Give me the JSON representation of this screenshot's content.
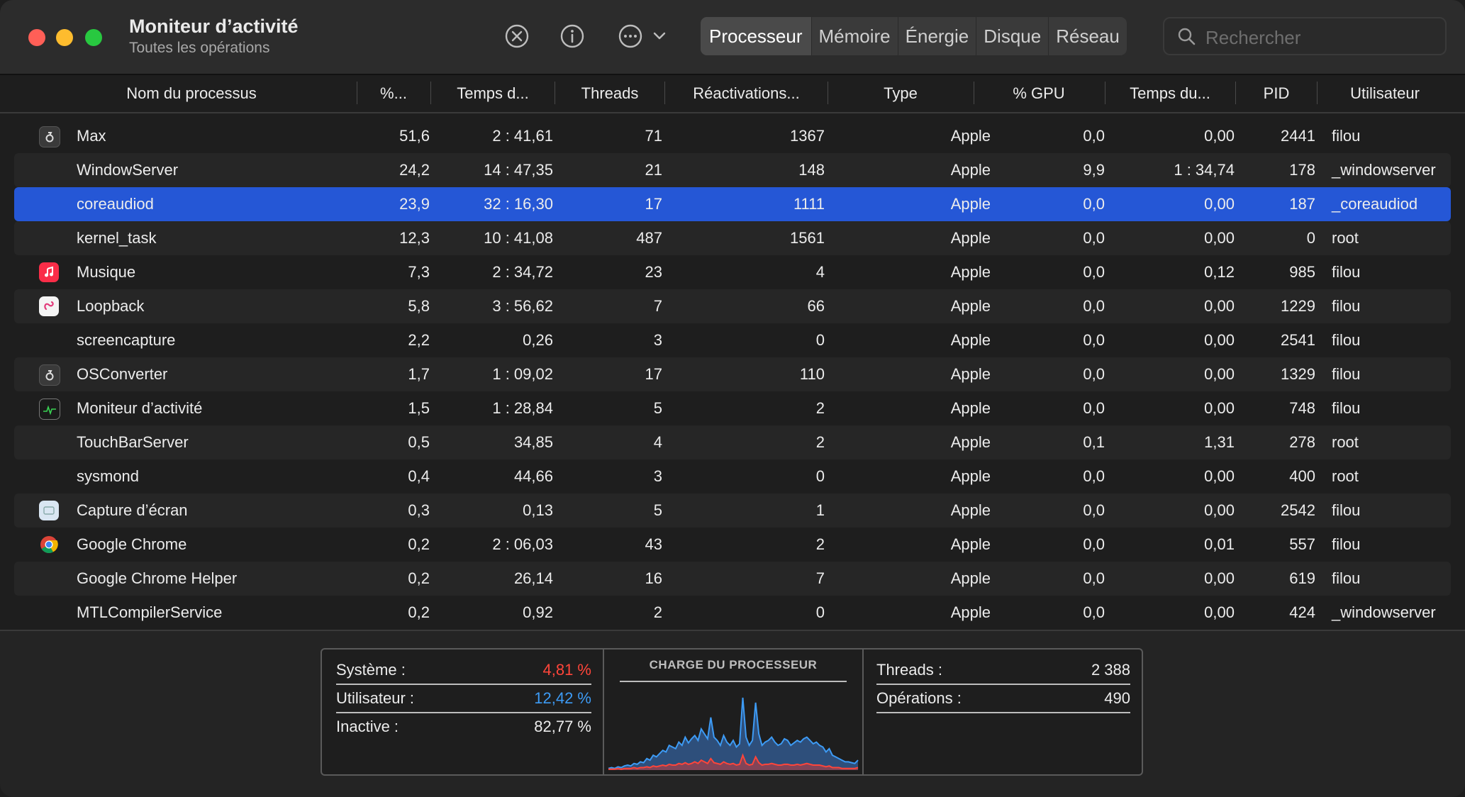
{
  "window": {
    "title": "Moniteur d’activité",
    "subtitle": "Toutes les opérations"
  },
  "toolbar": {
    "icons": [
      "stop-process-icon",
      "info-icon",
      "more-actions-icon",
      "chevron-down-icon"
    ],
    "tabs": [
      {
        "label": "Processeur",
        "active": true
      },
      {
        "label": "Mémoire",
        "active": false
      },
      {
        "label": "Énergie",
        "active": false
      },
      {
        "label": "Disque",
        "active": false
      },
      {
        "label": "Réseau",
        "active": false
      }
    ],
    "search_placeholder": "Rechercher"
  },
  "table": {
    "columns": [
      "Nom du processus",
      "%...",
      "Temps d...",
      "Threads",
      "Réactivations...",
      "Type",
      "% GPU",
      "Temps du...",
      "PID",
      "Utilisateur"
    ],
    "rows": [
      {
        "icon": "max-app-icon",
        "name": "Max",
        "cpu": "51,6",
        "time": "2 : 41,61",
        "threads": "71",
        "wakeups": "1367",
        "type": "Apple",
        "gpu": "0,0",
        "gputime": "0,00",
        "pid": "2441",
        "user": "filou"
      },
      {
        "icon": "",
        "name": "WindowServer",
        "cpu": "24,2",
        "time": "14 : 47,35",
        "threads": "21",
        "wakeups": "148",
        "type": "Apple",
        "gpu": "9,9",
        "gputime": "1 : 34,74",
        "pid": "178",
        "user": "_windowserver"
      },
      {
        "icon": "",
        "name": "coreaudiod",
        "cpu": "23,9",
        "time": "32 : 16,30",
        "threads": "17",
        "wakeups": "1111",
        "type": "Apple",
        "gpu": "0,0",
        "gputime": "0,00",
        "pid": "187",
        "user": "_coreaudiod",
        "selected": true
      },
      {
        "icon": "",
        "name": "kernel_task",
        "cpu": "12,3",
        "time": "10 : 41,08",
        "threads": "487",
        "wakeups": "1561",
        "type": "Apple",
        "gpu": "0,0",
        "gputime": "0,00",
        "pid": "0",
        "user": "root"
      },
      {
        "icon": "music-app-icon",
        "name": "Musique",
        "cpu": "7,3",
        "time": "2 : 34,72",
        "threads": "23",
        "wakeups": "4",
        "type": "Apple",
        "gpu": "0,0",
        "gputime": "0,12",
        "pid": "985",
        "user": "filou"
      },
      {
        "icon": "loopback-app-icon",
        "name": "Loopback",
        "cpu": "5,8",
        "time": "3 : 56,62",
        "threads": "7",
        "wakeups": "66",
        "type": "Apple",
        "gpu": "0,0",
        "gputime": "0,00",
        "pid": "1229",
        "user": "filou"
      },
      {
        "icon": "",
        "name": "screencapture",
        "cpu": "2,2",
        "time": "0,26",
        "threads": "3",
        "wakeups": "0",
        "type": "Apple",
        "gpu": "0,0",
        "gputime": "0,00",
        "pid": "2541",
        "user": "filou"
      },
      {
        "icon": "osconverter-app-icon",
        "name": "OSConverter",
        "cpu": "1,7",
        "time": "1 : 09,02",
        "threads": "17",
        "wakeups": "110",
        "type": "Apple",
        "gpu": "0,0",
        "gputime": "0,00",
        "pid": "1329",
        "user": "filou"
      },
      {
        "icon": "activity-monitor-app-icon",
        "name": "Moniteur d’activité",
        "cpu": "1,5",
        "time": "1 : 28,84",
        "threads": "5",
        "wakeups": "2",
        "type": "Apple",
        "gpu": "0,0",
        "gputime": "0,00",
        "pid": "748",
        "user": "filou"
      },
      {
        "icon": "",
        "name": "TouchBarServer",
        "cpu": "0,5",
        "time": "34,85",
        "threads": "4",
        "wakeups": "2",
        "type": "Apple",
        "gpu": "0,1",
        "gputime": "1,31",
        "pid": "278",
        "user": "root"
      },
      {
        "icon": "",
        "name": "sysmond",
        "cpu": "0,4",
        "time": "44,66",
        "threads": "3",
        "wakeups": "0",
        "type": "Apple",
        "gpu": "0,0",
        "gputime": "0,00",
        "pid": "400",
        "user": "root"
      },
      {
        "icon": "screenshot-app-icon",
        "name": "Capture d’écran",
        "cpu": "0,3",
        "time": "0,13",
        "threads": "5",
        "wakeups": "1",
        "type": "Apple",
        "gpu": "0,0",
        "gputime": "0,00",
        "pid": "2542",
        "user": "filou"
      },
      {
        "icon": "chrome-app-icon",
        "name": "Google Chrome",
        "cpu": "0,2",
        "time": "2 : 06,03",
        "threads": "43",
        "wakeups": "2",
        "type": "Apple",
        "gpu": "0,0",
        "gputime": "0,01",
        "pid": "557",
        "user": "filou"
      },
      {
        "icon": "",
        "name": "Google Chrome Helper",
        "cpu": "0,2",
        "time": "26,14",
        "threads": "16",
        "wakeups": "7",
        "type": "Apple",
        "gpu": "0,0",
        "gputime": "0,00",
        "pid": "619",
        "user": "filou"
      },
      {
        "icon": "",
        "name": "MTLCompilerService",
        "cpu": "0,2",
        "time": "0,92",
        "threads": "2",
        "wakeups": "0",
        "type": "Apple",
        "gpu": "0,0",
        "gputime": "0,00",
        "pid": "424",
        "user": "_windowserver"
      }
    ]
  },
  "summary": {
    "system_label": "Système :",
    "system_value": "4,81 %",
    "user_label": "Utilisateur :",
    "user_value": "12,42 %",
    "idle_label": "Inactive :",
    "idle_value": "82,77 %",
    "chart_title": "CHARGE DU PROCESSEUR",
    "threads_label": "Threads :",
    "threads_value": "2 388",
    "processes_label": "Opérations :",
    "processes_value": "490"
  },
  "colors": {
    "system": "#ff453a",
    "user": "#3d9bf5",
    "selected_row": "#2557d6"
  },
  "cpu_load_chart": {
    "total": [
      2,
      3,
      2,
      4,
      3,
      5,
      6,
      5,
      8,
      7,
      10,
      9,
      14,
      12,
      18,
      16,
      20,
      24,
      22,
      30,
      28,
      26,
      34,
      30,
      40,
      33,
      38,
      42,
      36,
      50,
      44,
      38,
      64,
      40,
      36,
      30,
      42,
      34,
      30,
      36,
      28,
      32,
      88,
      40,
      30,
      36,
      82,
      44,
      30,
      34,
      36,
      40,
      34,
      30,
      32,
      38,
      36,
      30,
      33,
      36,
      34,
      38,
      40,
      36,
      32,
      34,
      30,
      28,
      22,
      26,
      18,
      16,
      14,
      12,
      10,
      10,
      9,
      8,
      12
    ],
    "system": [
      1,
      1,
      1,
      2,
      1,
      2,
      2,
      2,
      3,
      2,
      3,
      3,
      4,
      3,
      5,
      4,
      5,
      6,
      5,
      7,
      6,
      6,
      8,
      7,
      9,
      7,
      8,
      10,
      8,
      12,
      10,
      8,
      14,
      9,
      8,
      7,
      10,
      8,
      7,
      8,
      6,
      7,
      18,
      8,
      6,
      7,
      16,
      9,
      6,
      7,
      7,
      8,
      7,
      6,
      6,
      7,
      7,
      6,
      6,
      7,
      6,
      7,
      8,
      7,
      6,
      6,
      6,
      5,
      4,
      5,
      3,
      3,
      3,
      2,
      2,
      2,
      2,
      2,
      3
    ]
  }
}
